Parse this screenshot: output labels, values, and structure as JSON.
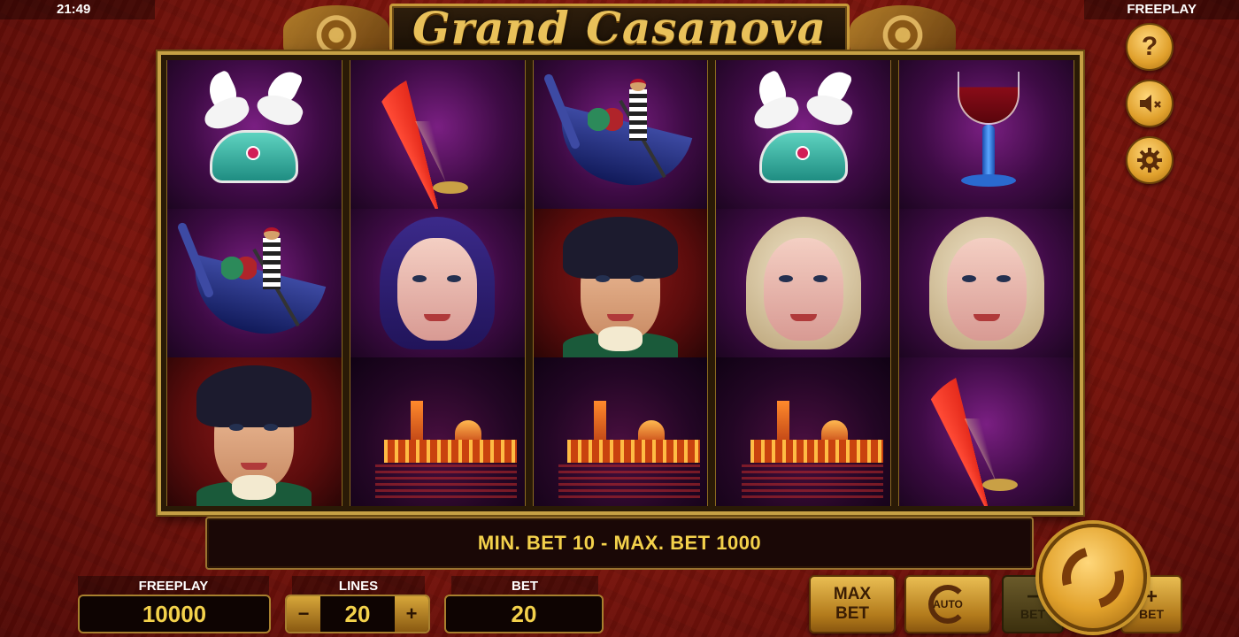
{
  "status": {
    "time": "21:49",
    "mode": "FREEPLAY"
  },
  "title": "Grand Casanova",
  "side_buttons": {
    "help": "?",
    "sound_icon": "sound-muted-icon",
    "settings_icon": "gear-icon"
  },
  "reels": [
    [
      "jewelry-box-doves",
      "gondola",
      "casanova"
    ],
    [
      "fan",
      "dark-haired-woman",
      "venice-night"
    ],
    [
      "gondola",
      "casanova",
      "venice-night"
    ],
    [
      "jewelry-box-doves",
      "blonde-woman",
      "venice-night"
    ],
    [
      "wine-goblet",
      "blonde-woman",
      "fan"
    ]
  ],
  "message": "MIN. BET 10 - MAX. BET 1000",
  "panels": {
    "balance_label": "FREEPLAY",
    "balance_value": "10000",
    "lines_label": "LINES",
    "lines_value": "20",
    "bet_label": "BET",
    "bet_value": "20"
  },
  "buttons": {
    "max_line1": "MAX",
    "max_line2": "BET",
    "auto": "AUTO",
    "bet_minus": "BET",
    "bet_plus": "BET",
    "minus": "−",
    "plus": "+"
  },
  "colors": {
    "accent_gold": "#c6a045",
    "message_text": "#f3d14b",
    "background": "#7a140c"
  }
}
